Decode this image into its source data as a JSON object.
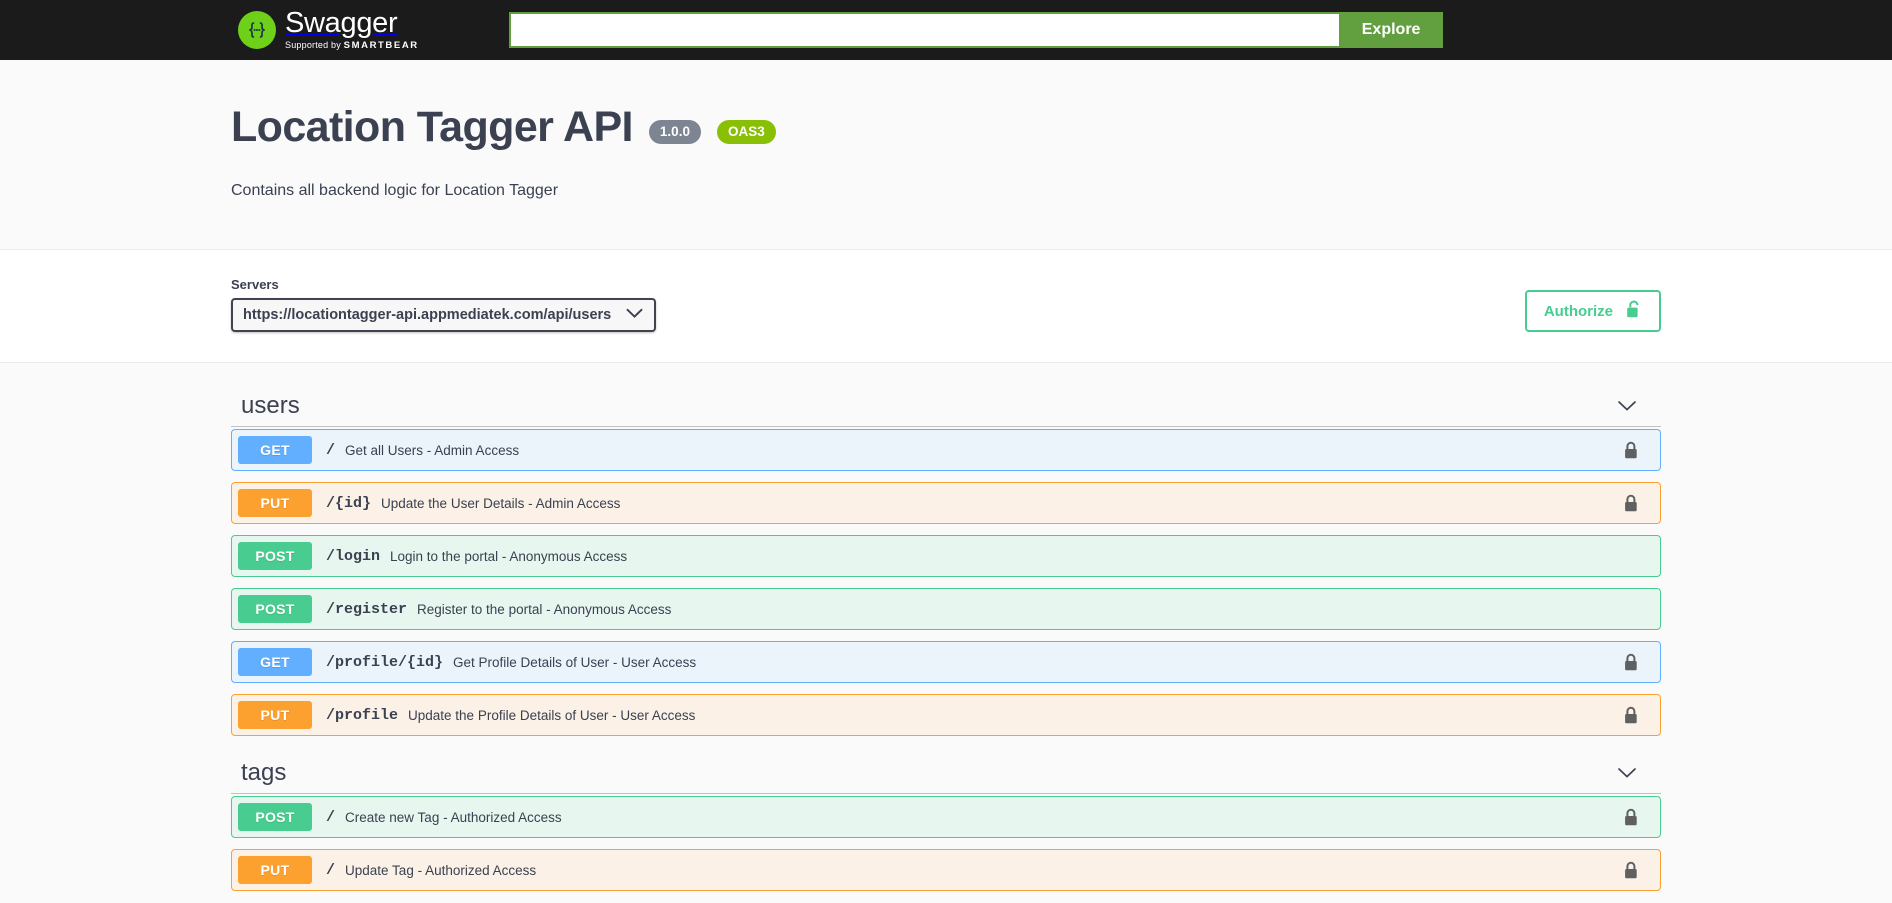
{
  "topbar": {
    "logo_title": "Swagger",
    "logo_supported_prefix": "Supported by",
    "logo_supported_brand": "SMARTBEAR",
    "logo_icon": "swagger-braces-logo",
    "search_value": "",
    "search_placeholder": "",
    "explore_label": "Explore"
  },
  "info": {
    "title": "Location Tagger API",
    "version_badge": "1.0.0",
    "oas_badge": "OAS3",
    "description": "Contains all backend logic for Location Tagger"
  },
  "scheme": {
    "servers_label": "Servers",
    "selected_server": "https://locationtagger-api.appmediatek.com/api/users",
    "server_options": [
      "https://locationtagger-api.appmediatek.com/api/users"
    ],
    "caret_icon": "chevron-down-icon",
    "authorize_label": "Authorize",
    "authorize_icon": "unlock-icon"
  },
  "colors": {
    "get": "#61affe",
    "post": "#49cc90",
    "put": "#fca130",
    "oas_badge": "#89bf04",
    "version_badge": "#7d8492",
    "explore": "#62a03f",
    "topbar": "#1b1b1b",
    "authorize_green": "#49cc90"
  },
  "tags": [
    {
      "name": "users",
      "chevron_icon": "chevron-down-icon",
      "operations": [
        {
          "method": "GET",
          "path": "/",
          "summary": "Get all Users - Admin Access",
          "locked": true,
          "lock_icon": "lock-icon"
        },
        {
          "method": "PUT",
          "path": "/{id}",
          "summary": "Update the User Details - Admin Access",
          "locked": true,
          "lock_icon": "lock-icon"
        },
        {
          "method": "POST",
          "path": "/login",
          "summary": "Login to the portal - Anonymous Access",
          "locked": false,
          "lock_icon": ""
        },
        {
          "method": "POST",
          "path": "/register",
          "summary": "Register to the portal - Anonymous Access",
          "locked": false,
          "lock_icon": ""
        },
        {
          "method": "GET",
          "path": "/profile/{id}",
          "summary": "Get Profile Details of User - User Access",
          "locked": true,
          "lock_icon": "lock-icon"
        },
        {
          "method": "PUT",
          "path": "/profile",
          "summary": "Update the Profile Details of User - User Access",
          "locked": true,
          "lock_icon": "lock-icon"
        }
      ]
    },
    {
      "name": "tags",
      "chevron_icon": "chevron-down-icon",
      "operations": [
        {
          "method": "POST",
          "path": "/",
          "summary": "Create new Tag - Authorized Access",
          "locked": true,
          "lock_icon": "lock-icon"
        },
        {
          "method": "PUT",
          "path": "/",
          "summary": "Update Tag - Authorized Access",
          "locked": true,
          "lock_icon": "lock-icon"
        }
      ]
    }
  ]
}
